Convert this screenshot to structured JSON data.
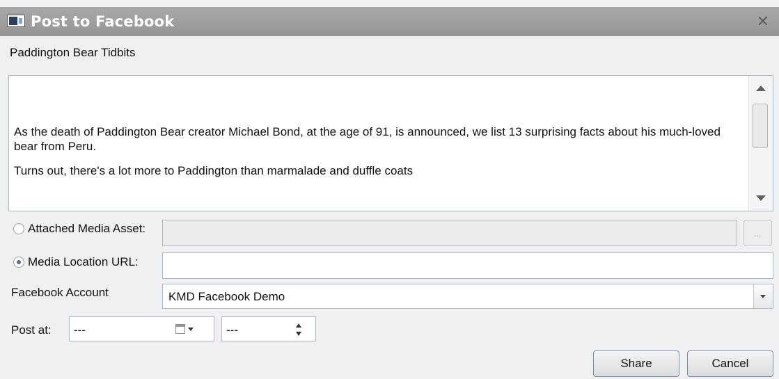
{
  "window": {
    "title": "Post to Facebook",
    "close_glyph": "✕"
  },
  "subject": "Paddington Bear Tidbits",
  "body": {
    "paragraph1": "As the death of Paddington Bear creator Michael Bond, at the age of 91, is announced, we list 13 surprising facts about his much-loved bear from Peru.",
    "paragraph2": "Turns out, there's a lot more to Paddington than marmalade and duffle coats"
  },
  "media": {
    "attached_label": "Attached Media Asset:",
    "attached_value": "",
    "attached_selected": false,
    "browse_label": "...",
    "url_label": "Media Location URL:",
    "url_value": "",
    "url_selected": true
  },
  "account": {
    "label": "Facebook Account",
    "selected": "KMD Facebook Demo"
  },
  "post_at": {
    "label": "Post at:",
    "date_value": "---",
    "time_value": "---"
  },
  "buttons": {
    "share": "Share",
    "cancel": "Cancel"
  },
  "icons": {
    "window_icon": "app-window-icon",
    "close": "close-icon",
    "calendar": "calendar-icon"
  }
}
